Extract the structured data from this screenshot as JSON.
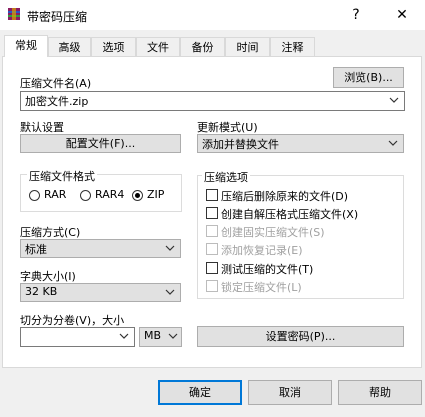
{
  "window": {
    "title": "带密码压缩",
    "help_glyph": "?",
    "close_glyph": "✕"
  },
  "tabs": [
    {
      "label": "常规",
      "active": true
    },
    {
      "label": "高级"
    },
    {
      "label": "选项"
    },
    {
      "label": "文件"
    },
    {
      "label": "备份"
    },
    {
      "label": "时间"
    },
    {
      "label": "注释"
    }
  ],
  "archive": {
    "name_label": "压缩文件名(A)",
    "name_value": "加密文件.zip",
    "browse_label": "浏览(B)..."
  },
  "defaults": {
    "label": "默认设置",
    "profiles_button": "配置文件(F)..."
  },
  "update_mode": {
    "label": "更新模式(U)",
    "value": "添加并替换文件"
  },
  "format": {
    "group_label": "压缩文件格式",
    "options": [
      {
        "label": "RAR",
        "checked": false
      },
      {
        "label": "RAR4",
        "checked": false
      },
      {
        "label": "ZIP",
        "checked": true
      }
    ]
  },
  "method": {
    "label": "压缩方式(C)",
    "value": "标准"
  },
  "dictionary": {
    "label": "字典大小(I)",
    "value": "32 KB"
  },
  "split": {
    "label": "切分为分卷(V)，大小",
    "value": "",
    "unit": "MB"
  },
  "password_button": "设置密码(P)...",
  "options": {
    "group_label": "压缩选项",
    "items": [
      {
        "label": "压缩后删除原来的文件(D)",
        "checked": false,
        "enabled": true
      },
      {
        "label": "创建自解压格式压缩文件(X)",
        "checked": false,
        "enabled": true
      },
      {
        "label": "创建固实压缩文件(S)",
        "checked": false,
        "enabled": false
      },
      {
        "label": "添加恢复记录(E)",
        "checked": false,
        "enabled": false
      },
      {
        "label": "测试压缩的文件(T)",
        "checked": false,
        "enabled": true
      },
      {
        "label": "锁定压缩文件(L)",
        "checked": false,
        "enabled": false
      }
    ]
  },
  "footer": {
    "ok": "确定",
    "cancel": "取消",
    "help": "帮助"
  }
}
